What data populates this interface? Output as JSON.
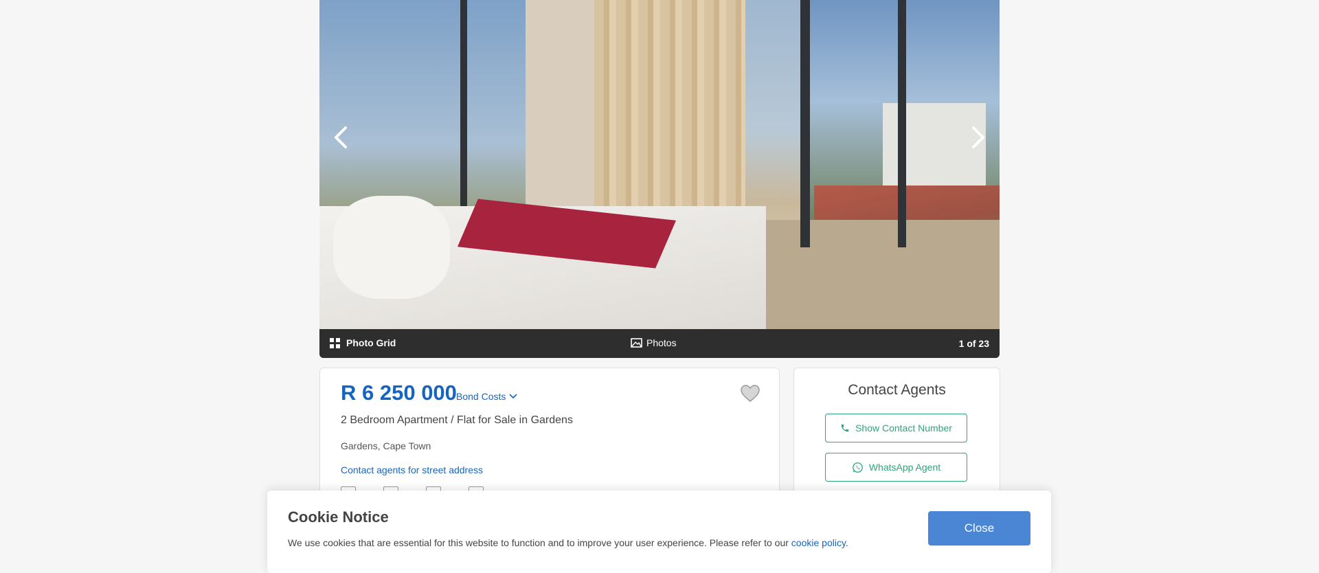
{
  "gallery": {
    "photo_grid_label": "Photo Grid",
    "photos_label": "Photos",
    "counter": "1 of 23"
  },
  "listing": {
    "price": "R 6 250 000",
    "bond_costs_label": "Bond Costs",
    "title": "2 Bedroom Apartment / Flat for Sale in Gardens",
    "location": "Gardens, Cape Town",
    "address_link": "Contact agents for street address"
  },
  "contact": {
    "title": "Contact Agents",
    "show_number_label": "Show Contact Number",
    "whatsapp_label": "WhatsApp Agent"
  },
  "cookie": {
    "title": "Cookie Notice",
    "text": "We use cookies that are essential for this website to function and to improve your user experience. Please refer to our ",
    "link": "cookie policy",
    "after_link": ".",
    "close_label": "Close"
  },
  "colors": {
    "accent_blue": "#1565c0",
    "contact_green": "#2aa876",
    "close_button": "#4a86d4",
    "gallery_bar": "#2e2e2e"
  },
  "icons": [
    "chevron-left-icon",
    "chevron-right-icon",
    "grid-icon",
    "image-icon",
    "chevron-down-icon",
    "heart-icon",
    "phone-icon",
    "whatsapp-icon",
    "bed-icon",
    "bath-icon",
    "parking-icon",
    "size-icon"
  ]
}
